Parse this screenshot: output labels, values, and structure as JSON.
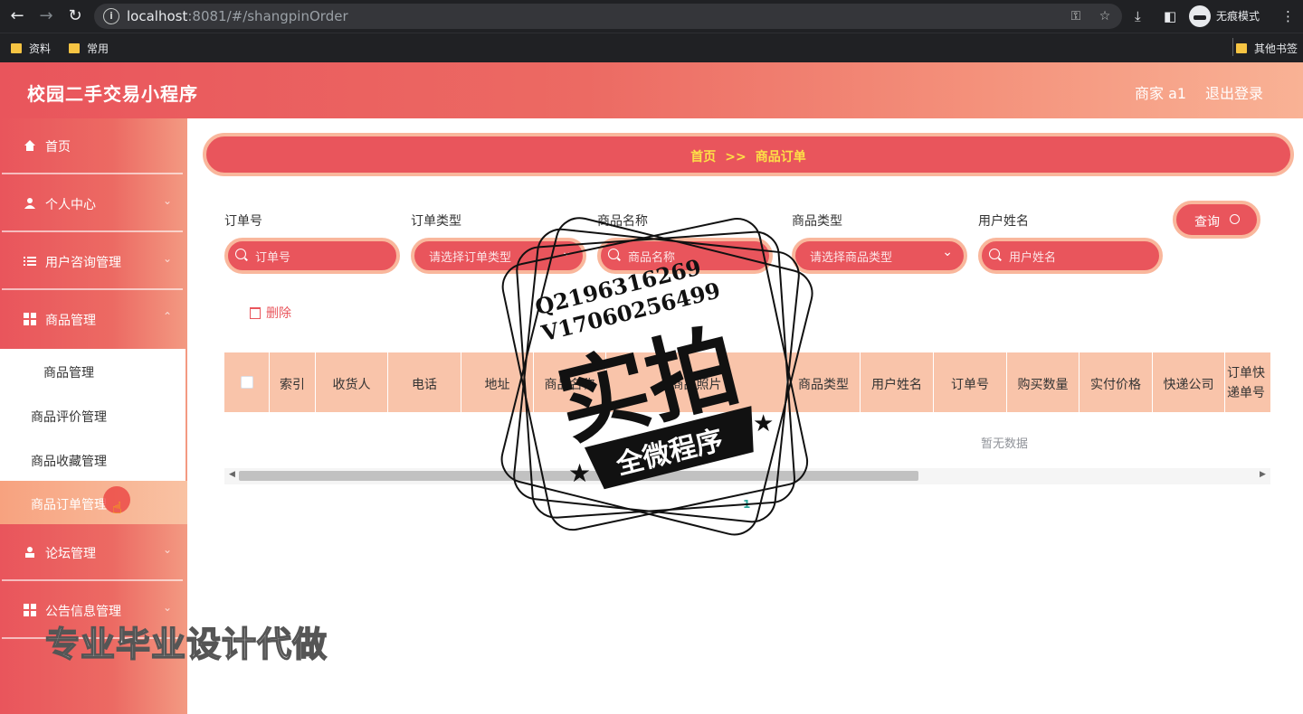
{
  "browser": {
    "url_host": "localhost",
    "url_rest": ":8081/#/shangpinOrder",
    "profile_label": "无痕模式",
    "bookmarks": [
      "资料",
      "常用"
    ],
    "other_bookmarks": "其他书签"
  },
  "header": {
    "title": "校园二手交易小程序",
    "user": "商家 a1",
    "logout": "退出登录"
  },
  "sidebar": {
    "items": [
      {
        "label": "首页"
      },
      {
        "label": "个人中心"
      },
      {
        "label": "用户咨询管理"
      },
      {
        "label": "商品管理"
      },
      {
        "label": "论坛管理"
      },
      {
        "label": "公告信息管理"
      }
    ],
    "submenu": [
      "商品管理",
      "商品评价管理",
      "商品收藏管理",
      "商品订单管理"
    ]
  },
  "breadcrumb": {
    "home": "首页",
    "sep": ">>",
    "current": "商品订单"
  },
  "filters": {
    "order_no": {
      "label": "订单号",
      "placeholder": "订单号"
    },
    "order_type": {
      "label": "订单类型",
      "placeholder": "请选择订单类型"
    },
    "product_name": {
      "label": "商品名称",
      "placeholder": "商品名称"
    },
    "product_type": {
      "label": "商品类型",
      "placeholder": "请选择商品类型"
    },
    "user_name": {
      "label": "用户姓名",
      "placeholder": "用户姓名"
    },
    "query": "查询"
  },
  "actions": {
    "delete": "删除"
  },
  "table": {
    "columns": [
      "索引",
      "收货人",
      "电话",
      "地址",
      "商品名称",
      "商品照片",
      "商品类型",
      "用户姓名",
      "订单号",
      "购买数量",
      "实付价格",
      "快递公司",
      "订单快递单号"
    ],
    "empty_text": "暂无数据"
  },
  "pagination": {
    "page": "1"
  },
  "overlay": {
    "qq": "Q2196316269",
    "wx": "V17060256499",
    "stamp_big": "实拍",
    "stamp_banner": "全微程序",
    "watermark": "专业毕业设计代做"
  },
  "colors": {
    "primary": "#e9555c",
    "accent_light": "#f9b79c",
    "table_head": "#f9c4aa",
    "breadcrumb_text": "#fde047"
  }
}
